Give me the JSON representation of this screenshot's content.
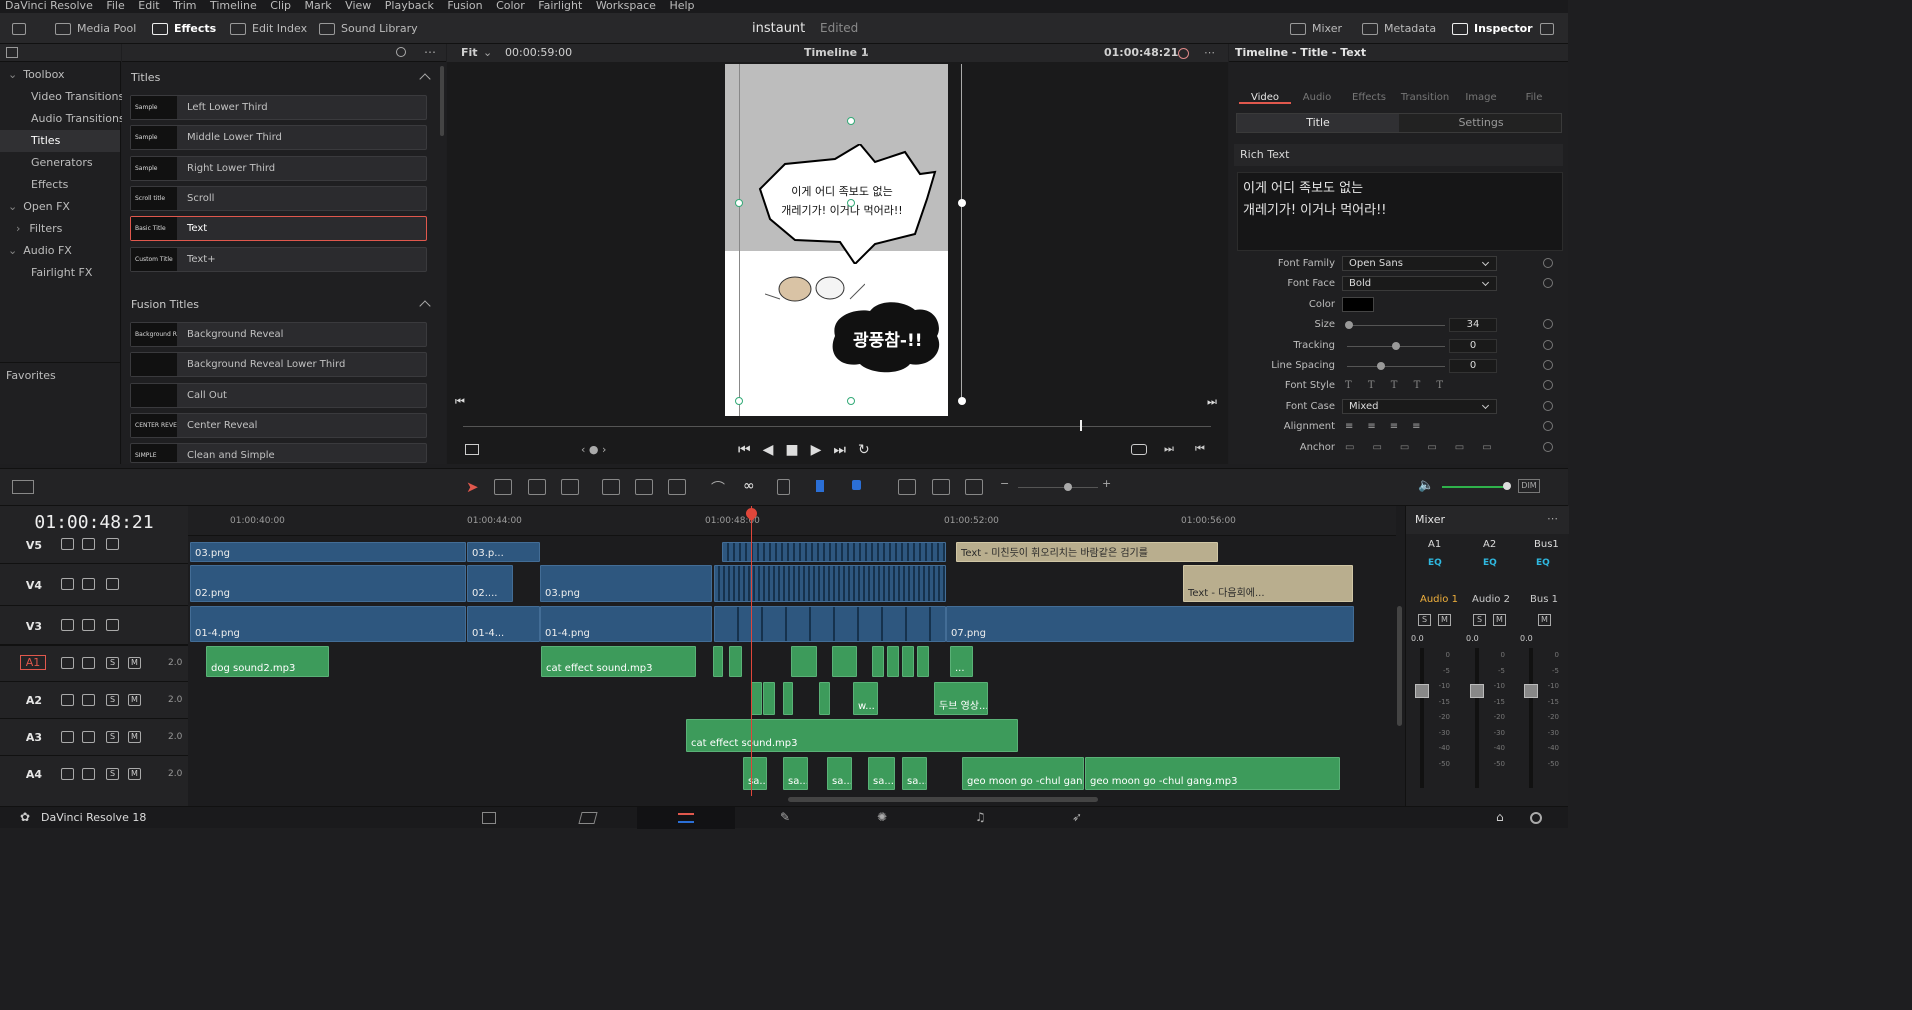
{
  "menu": {
    "app": "DaVinci Resolve",
    "items": [
      "File",
      "Edit",
      "Trim",
      "Timeline",
      "Clip",
      "Mark",
      "View",
      "Playback",
      "Fusion",
      "Color",
      "Fairlight",
      "Workspace",
      "Help"
    ]
  },
  "topbar": {
    "media_pool": "Media Pool",
    "effects": "Effects",
    "edit_index": "Edit Index",
    "sound_library": "Sound Library",
    "project": "instaunt",
    "status": "Edited",
    "mixer": "Mixer",
    "metadata": "Metadata",
    "inspector": "Inspector"
  },
  "effects_tree": {
    "toolbox": "Toolbox",
    "video_transitions": "Video Transitions",
    "audio_transitions": "Audio Transitions",
    "titles": "Titles",
    "generators": "Generators",
    "effects": "Effects",
    "open_fx": "Open FX",
    "filters": "Filters",
    "audio_fx": "Audio FX",
    "fairlight_fx": "Fairlight FX",
    "favorites": "Favorites"
  },
  "titles_section": {
    "header": "Titles",
    "items": [
      {
        "thumb": "Sample",
        "label": "Left Lower Third"
      },
      {
        "thumb": "Sample",
        "label": "Middle Lower Third"
      },
      {
        "thumb": "Sample",
        "label": "Right Lower Third"
      },
      {
        "thumb": "Scroll title",
        "label": "Scroll"
      },
      {
        "thumb": "Basic Title",
        "label": "Text"
      },
      {
        "thumb": "Custom Title",
        "label": "Text+"
      }
    ]
  },
  "fusion_section": {
    "header": "Fusion Titles",
    "items": [
      {
        "thumb": "Background Reveal",
        "label": "Background Reveal"
      },
      {
        "thumb": "",
        "label": "Background Reveal Lower Third"
      },
      {
        "thumb": "",
        "label": "Call Out"
      },
      {
        "thumb": "CENTER REVEAL",
        "label": "Center Reveal"
      },
      {
        "thumb": "SIMPLE",
        "label": "Clean and Simple"
      }
    ]
  },
  "viewer": {
    "fit": "Fit",
    "duration": "00:00:59:00",
    "timeline": "Timeline 1",
    "timecode": "01:00:48:21",
    "bubble_line1": "이게 어디 족보도 없는",
    "bubble_line2": "개레기가! 이거나 먹어라!!",
    "burst_text": "광풍참-!!"
  },
  "inspector": {
    "header": "Timeline - Title - Text",
    "tabs": [
      "Video",
      "Audio",
      "Effects",
      "Transition",
      "Image",
      "File"
    ],
    "sub_tabs": [
      "Title",
      "Settings"
    ],
    "rich_text_label": "Rich Text",
    "rich_text_line1": "이게 어디 족보도 없는",
    "rich_text_line2": "개레기가! 이거나 먹어라!!",
    "font_family_label": "Font Family",
    "font_family": "Open Sans",
    "font_face_label": "Font Face",
    "font_face": "Bold",
    "color_label": "Color",
    "size_label": "Size",
    "size": "34",
    "tracking_label": "Tracking",
    "tracking": "0",
    "line_spacing_label": "Line Spacing",
    "line_spacing": "0",
    "font_style_label": "Font Style",
    "font_case_label": "Font Case",
    "font_case": "Mixed",
    "alignment_label": "Alignment",
    "anchor_label": "Anchor",
    "text_color": "#000000",
    "size_level": 0.02,
    "tracking_level": 0.5,
    "line_spacing_level": 0.35
  },
  "timeline": {
    "timecode": "01:00:48:21",
    "ruler": [
      "01:00:40:00",
      "01:00:44:00",
      "01:00:48:00",
      "01:00:52:00",
      "01:00:56:00"
    ],
    "tracks": [
      {
        "name": "V5"
      },
      {
        "name": "V4"
      },
      {
        "name": "V3"
      },
      {
        "name": "A1",
        "level": "2.0"
      },
      {
        "name": "A2",
        "level": "2.0"
      },
      {
        "name": "A3",
        "level": "2.0"
      },
      {
        "name": "A4",
        "level": "2.0"
      }
    ],
    "clips": {
      "v5_a": "03.png",
      "v5_b": "03.p...",
      "v5_text": "Text - 미친듯이 휘오리치는 바람같은 검기를",
      "v4_a": "02.png",
      "v4_b": "02....",
      "v4_c": "03.png",
      "v4_text": "Text - 다음회에...",
      "v3_a": "01-4.png",
      "v3_b": "01-4...",
      "v3_c": "01-4.png",
      "v3_d": "07.png",
      "a1_a": "dog sound2.mp3",
      "a1_b": "cat effect sound.mp3",
      "a1_c": "...",
      "a2_a": "w...",
      "a2_b": "두브 영상...",
      "a3_a": "cat effect sound.mp3",
      "a4_a": "sa...",
      "a4_b": "sa...",
      "a4_c": "sa...",
      "a4_d": "sa...",
      "a4_e": "sa...",
      "a4_f": "geo moon go -chul gang....",
      "a4_g": "geo moon go -chul gang.mp3"
    }
  },
  "mixer": {
    "title": "Mixer",
    "channels": [
      "A1",
      "A2",
      "Bus1"
    ],
    "names": [
      "Audio 1",
      "Audio 2",
      "Bus 1"
    ],
    "eq": "EQ",
    "gain": [
      "0.0",
      "0.0",
      "0.0"
    ],
    "scale": [
      "0",
      "-5",
      "-10",
      "-15",
      "-20",
      "-30",
      "-40",
      "-50"
    ],
    "dim": "DIM"
  },
  "status": {
    "app": "DaVinci Resolve 18"
  },
  "colors": {
    "accent_red": "#e0584d",
    "video_clip": "#2e577f",
    "audio_clip": "#3d9b5b",
    "title_clip": "#b9ae8e"
  }
}
